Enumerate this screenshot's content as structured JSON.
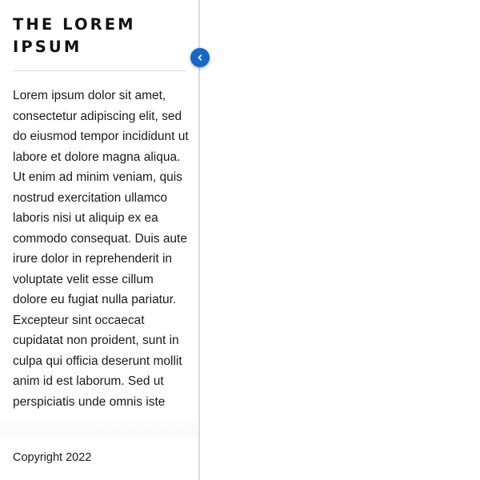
{
  "sidebar": {
    "title": "THE LOREM IPSUM",
    "body": "Lorem ipsum dolor sit amet, consectetur adipiscing elit, sed do eiusmod tempor incididunt ut labore et dolore magna aliqua. Ut enim ad minim veniam, quis nostrud exercitation ullamco laboris nisi ut aliquip ex ea commodo consequat. Duis aute irure dolor in reprehenderit in voluptate velit esse cillum dolore eu fugiat nulla pariatur. Excepteur sint occaecat cupidatat non proident, sunt in culpa qui officia deserunt mollit anim id est laborum. Sed ut perspiciatis unde omnis iste",
    "footer": "Copyright 2022",
    "collapse_icon": "chevron-left-icon"
  },
  "colors": {
    "accent": "#1669c7",
    "divider": "#dcdcdc",
    "text": "#1b1b1b"
  }
}
